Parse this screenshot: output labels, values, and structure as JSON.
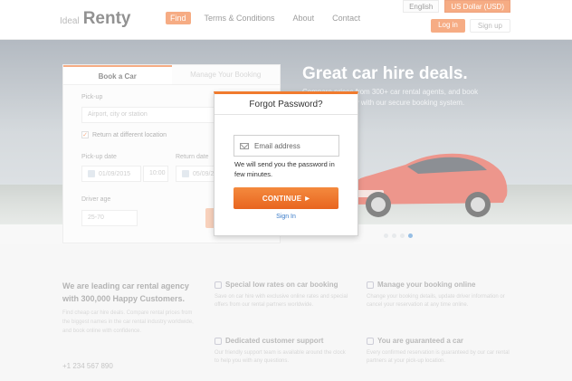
{
  "navbar": {
    "logo_pre": "Ideal",
    "logo_brand": "Renty",
    "items": [
      "Find",
      "Terms & Conditions",
      "About",
      "Contact"
    ],
    "language": "English",
    "currency": "US Dollar (USD)",
    "login_label": "Log in",
    "signup_label": "Sign up"
  },
  "hero": {
    "title": "Great car hire deals.",
    "subtitle": "Compare prices from 300+ car rental agents, and book quickly and easily with our secure booking system."
  },
  "booking": {
    "tabs": [
      "Book a Car",
      "Manage Your Booking"
    ],
    "pickup_label": "Pick-up",
    "pickup_placeholder": "Airport, city or station",
    "return_different": "Return at different location",
    "pickup_date_label": "Pick-up date",
    "pickup_date": "01/09/2015",
    "pickup_time": "10:00",
    "return_date_label": "Return date",
    "return_date": "05/09/2015",
    "age_label": "Driver age",
    "age_value": "25-70"
  },
  "features": {
    "lead_title": "We are leading car rental agency with 300,000 Happy Customers.",
    "lead_text": "Find cheap car hire deals. Compare rental prices from the biggest names in the car rental industry worldwide, and book online with confidence.",
    "lead_phone": "+1 234 567 890",
    "items": [
      {
        "title": "Special low rates on car booking",
        "text": "Save on car hire with exclusive online rates and special offers from our rental partners worldwide."
      },
      {
        "title": "Manage your booking online",
        "text": "Change your booking details, update driver information or cancel your reservation at any time online."
      },
      {
        "title": "Dedicated customer support",
        "text": "Our friendly support team is available around the clock to help you with any questions."
      },
      {
        "title": "You are guaranteed a car",
        "text": "Every confirmed reservation is guaranteed by our car rental partners at your pick-up location."
      }
    ]
  },
  "modal": {
    "title": "Forgot Password?",
    "email_placeholder": "Email address",
    "help_text": "We will send you the password in few minutes.",
    "continue_label": "CONTINUE",
    "signin_label": "Sign In"
  },
  "colors": {
    "accent": "#f07b2e",
    "link": "#3a7bc8"
  },
  "icons": {
    "email": "envelope-icon",
    "continue_arrow": "caret-right-icon"
  }
}
